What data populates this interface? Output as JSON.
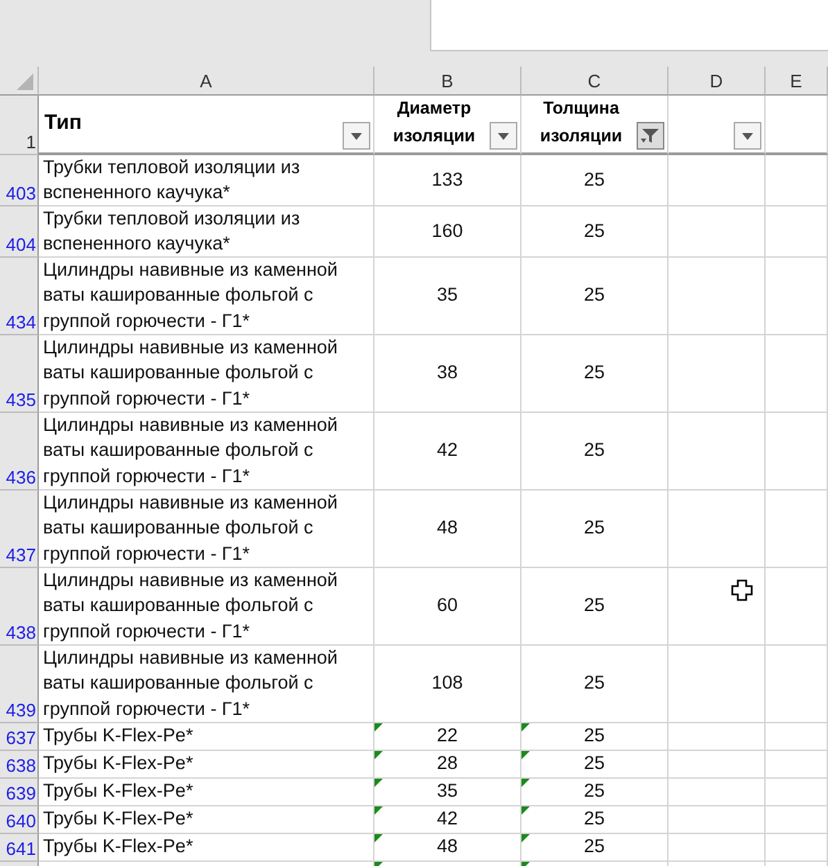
{
  "columns": [
    {
      "letter": "A",
      "header": "Тип",
      "filter_active": false
    },
    {
      "letter": "B",
      "header": "Диаметр изоляции",
      "filter_active": false
    },
    {
      "letter": "C",
      "header": "Толщина изоляции",
      "filter_active": true
    },
    {
      "letter": "D",
      "filter_active": false
    },
    {
      "letter": "E"
    }
  ],
  "header_row": "1",
  "rows": [
    {
      "number": "403",
      "type": "Трубки тепловой изоляции из вспененного каучука*",
      "diameter": "133",
      "thickness": "25"
    },
    {
      "number": "404",
      "type": "Трубки тепловой изоляции из вспененного каучука*",
      "diameter": "160",
      "thickness": "25"
    },
    {
      "number": "434",
      "type": "Цилиндры навивные из каменной ваты кашированные фольгой с группой горючести - Г1*",
      "diameter": "35",
      "thickness": "25"
    },
    {
      "number": "435",
      "type": "Цилиндры навивные из каменной ваты кашированные фольгой с группой горючести - Г1*",
      "diameter": "38",
      "thickness": "25"
    },
    {
      "number": "436",
      "type": "Цилиндры навивные из каменной ваты кашированные фольгой с группой горючести - Г1*",
      "diameter": "42",
      "thickness": "25"
    },
    {
      "number": "437",
      "type": "Цилиндры навивные из каменной ваты кашированные фольгой с группой горючести - Г1*",
      "diameter": "48",
      "thickness": "25"
    },
    {
      "number": "438",
      "type": "Цилиндры навивные из каменной ваты кашированные фольгой с группой горючести - Г1*",
      "diameter": "60",
      "thickness": "25"
    },
    {
      "number": "439",
      "type": "Цилиндры навивные из каменной ваты кашированные фольгой с группой горючести - Г1*",
      "diameter": "108",
      "thickness": "25"
    },
    {
      "number": "637",
      "type": "Трубы K-Flex-Pe*",
      "diameter": "22",
      "thickness": "25",
      "text_number": true
    },
    {
      "number": "638",
      "type": "Трубы K-Flex-Pe*",
      "diameter": "28",
      "thickness": "25",
      "text_number": true
    },
    {
      "number": "639",
      "type": "Трубы K-Flex-Pe*",
      "diameter": "35",
      "thickness": "25",
      "text_number": true
    },
    {
      "number": "640",
      "type": "Трубы K-Flex-Pe*",
      "diameter": "42",
      "thickness": "25",
      "text_number": true
    },
    {
      "number": "641",
      "type": "Трубы K-Flex-Pe*",
      "diameter": "48",
      "thickness": "25",
      "text_number": true
    }
  ]
}
